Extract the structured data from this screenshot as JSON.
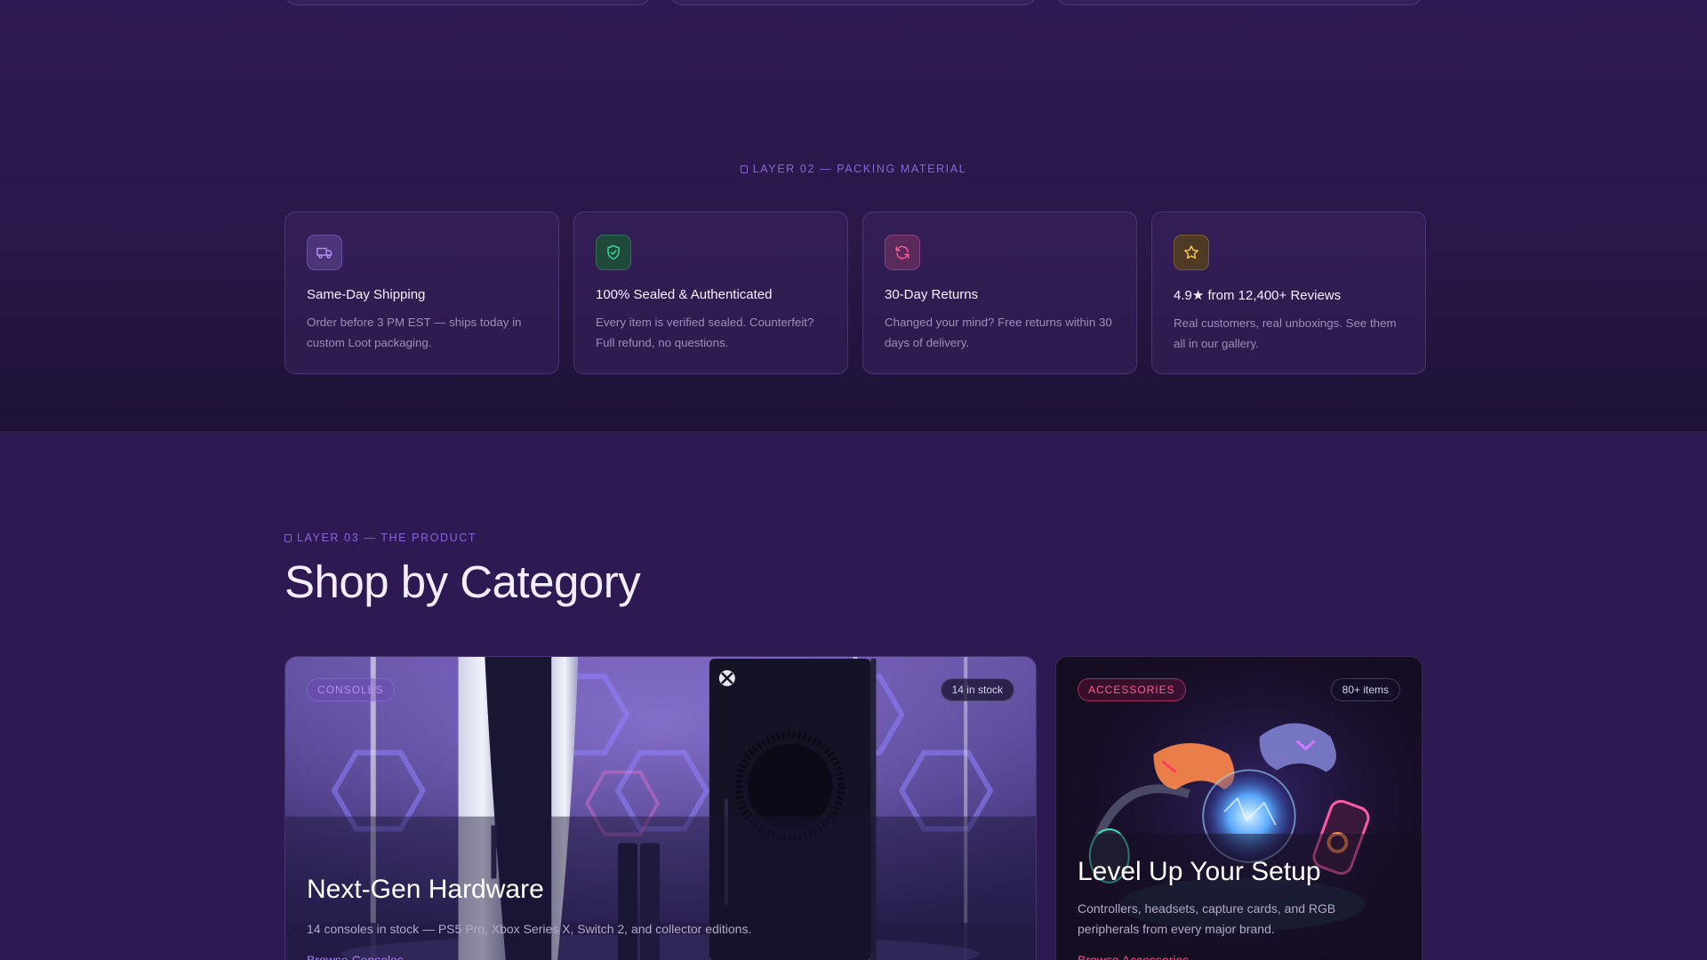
{
  "layer2": {
    "eyebrow": "LAYER 02 — PACKING MATERIAL",
    "features": [
      {
        "icon": "truck-icon",
        "title": "Same-Day Shipping",
        "desc": "Order before 3 PM EST — ships today in custom Loot packaging."
      },
      {
        "icon": "shield-check-icon",
        "title": "100% Sealed & Authenticated",
        "desc": "Every item is verified sealed. Counterfeit? Full refund, no questions."
      },
      {
        "icon": "refresh-icon",
        "title": "30-Day Returns",
        "desc": "Changed your mind? Free returns within 30 days of delivery."
      },
      {
        "icon": "star-icon",
        "title": "4.9★ from 12,400+ Reviews",
        "desc": "Real customers, real unboxings. See them all in our gallery."
      }
    ]
  },
  "layer3": {
    "eyebrow": "LAYER 03 — THE PRODUCT",
    "title": "Shop by Category",
    "categories": [
      {
        "tag": "CONSOLES",
        "badge": "14 in stock",
        "title": "Next-Gen Hardware",
        "desc": "14 consoles in stock — PS5 Pro, Xbox Series X, Switch 2, and collector editions.",
        "link": "Browse Consoles →"
      },
      {
        "tag": "ACCESSORIES",
        "badge": "80+ items",
        "title": "Level Up Your Setup",
        "desc": "Controllers, headsets, capture cards, and RGB peripherals from every major brand.",
        "link": "Browse Accessories →"
      }
    ]
  },
  "colors": {
    "accent_purple": "#8c63d9",
    "accent_pink": "#ff4f88",
    "background": "#2b1a4d"
  }
}
